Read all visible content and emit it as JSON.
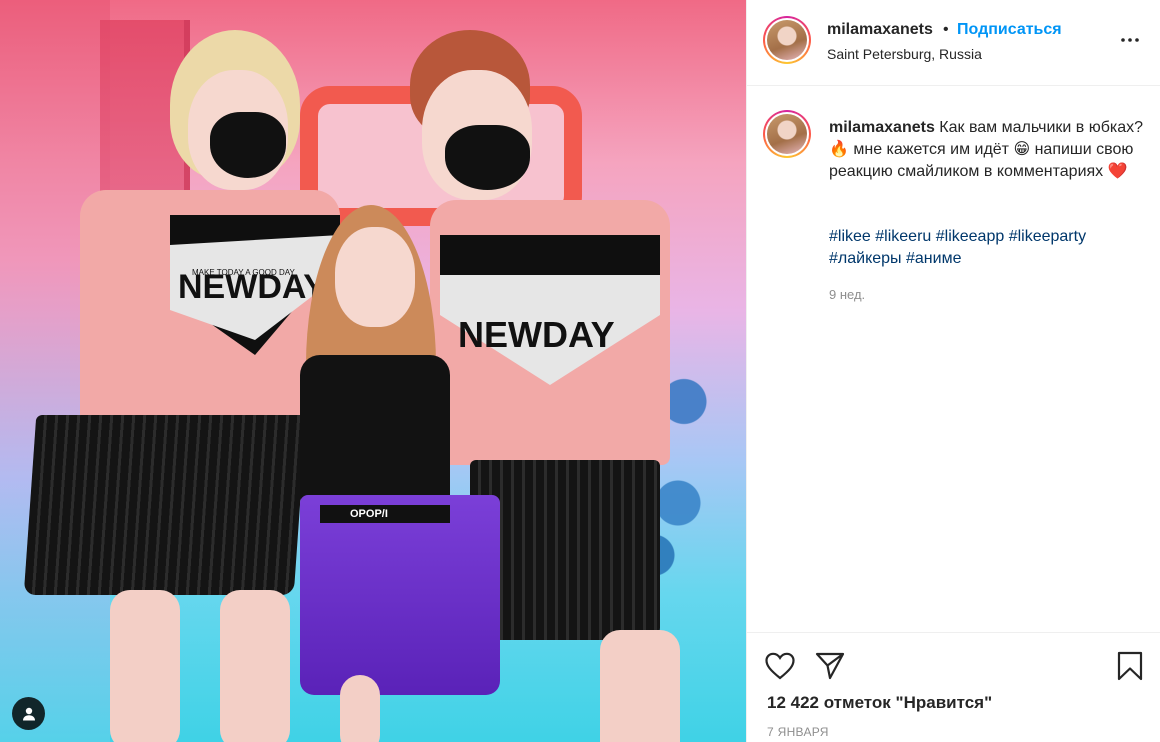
{
  "post": {
    "username": "milamaxanets",
    "separator": "•",
    "follow_label": "Подписаться",
    "location": "Saint Petersburg, Russia",
    "caption_text": "Как вам мальчики в юбках? 🔥 мне кажется им идёт 😁 напиши свою реакцию смайликом в комментариях ❤️",
    "hashtags": [
      "#likee",
      "#likeeru",
      "#likeeapp",
      "#likeeparty",
      "#лайкеры",
      "#аниме"
    ],
    "time_ago": "9 нед.",
    "likes_label": "12 422 отметок \"Нравится\"",
    "date": "7 ЯНВАРЯ"
  },
  "photo": {
    "sweater_print": "NEWDAY",
    "sweater_small": "MAKE TODAY A GOOD DAY",
    "belt_text": "OPOP/I"
  },
  "icons": {
    "more": "more-dots-icon",
    "like": "heart-icon",
    "share": "paper-plane-icon",
    "save": "bookmark-icon",
    "tagged": "user-icon"
  },
  "colors": {
    "accent": "#0095f6",
    "hashtag": "#00376b",
    "muted": "#8e8e8e",
    "text": "#262626",
    "border": "#efefef"
  }
}
